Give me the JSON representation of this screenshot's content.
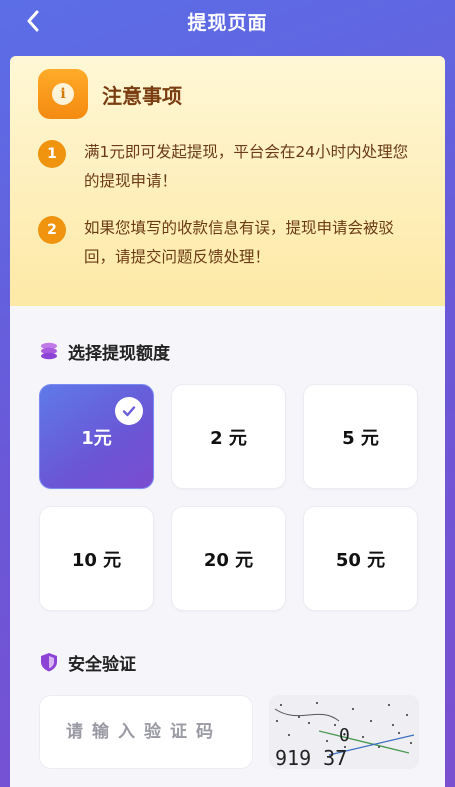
{
  "header": {
    "title": "提现页面"
  },
  "notice": {
    "title": "注意事项",
    "items": [
      {
        "num": "1",
        "text": "满1元即可发起提现，平台会在24小时内处理您的提现申请！"
      },
      {
        "num": "2",
        "text": "如果您填写的收款信息有误，提现申请会被驳回，请提交问题反馈处理！"
      }
    ]
  },
  "amount_section": {
    "title": "选择提现额度",
    "options": [
      "1元",
      "2 元",
      "5 元",
      "10 元",
      "20 元",
      "50 元"
    ],
    "selected_index": 0
  },
  "verify_section": {
    "title": "安全验证",
    "input_placeholder": "请输入验证码",
    "captcha_text": "919 37"
  },
  "colors": {
    "accent": "#6a58d8",
    "notice_number": "#f0930e",
    "notice_text": "#6b3b15"
  }
}
